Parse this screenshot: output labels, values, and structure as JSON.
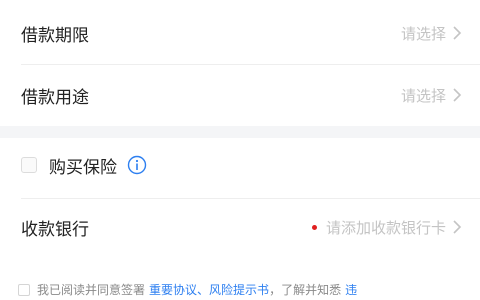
{
  "loan_term": {
    "label": "借款期限",
    "value": "请选择"
  },
  "loan_purpose": {
    "label": "借款用途",
    "value": "请选择"
  },
  "insurance": {
    "label": "购买保险"
  },
  "bank": {
    "label": "收款银行",
    "value": "请添加收款银行卡"
  },
  "agreement": {
    "prefix": "我已阅读并同意签署",
    "link1": "重要协议",
    "sep": "、",
    "link2": "风险提示书",
    "suffix": "，了解并知悉",
    "link3": "违"
  },
  "colors": {
    "accent": "#2d7ff0",
    "required_dot": "#e02020"
  },
  "icons": [
    "chevron-right-icon",
    "info-icon",
    "checkbox-icon"
  ]
}
